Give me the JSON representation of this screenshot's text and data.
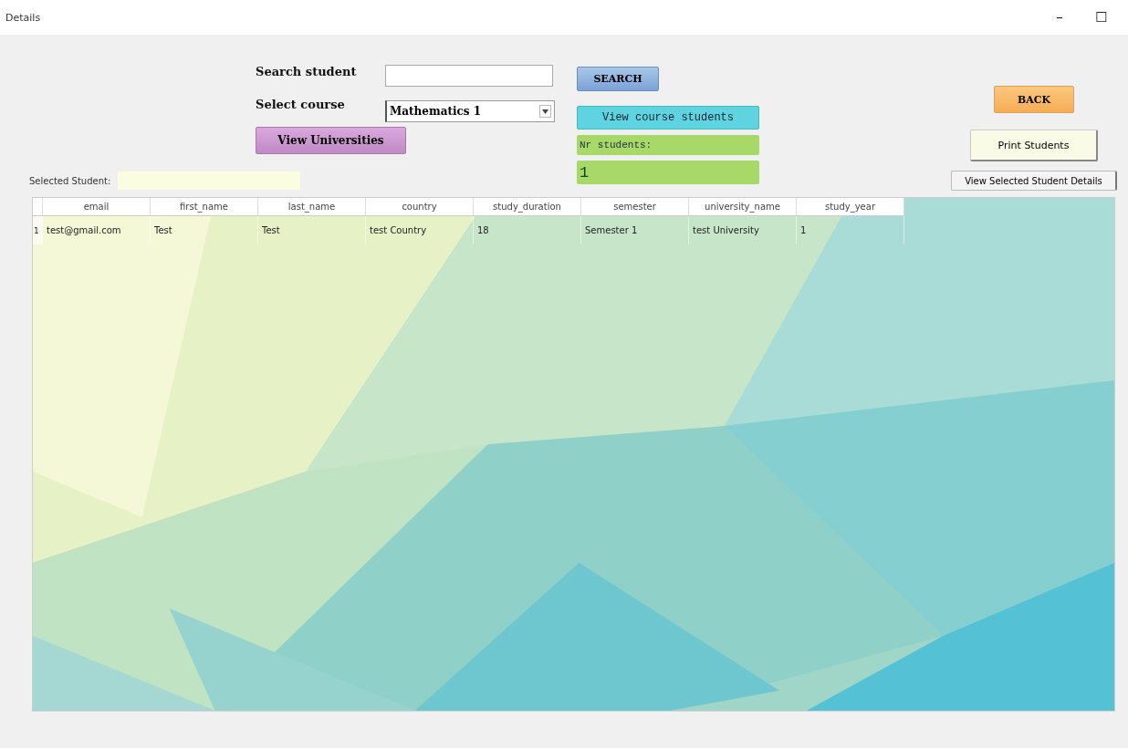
{
  "window": {
    "title": "Details",
    "controls": [
      "–",
      "☐"
    ]
  },
  "search": {
    "label": "Search student",
    "button": "SEARCH"
  },
  "course": {
    "label": "Select course",
    "value": "Mathematics 1",
    "button": "View course students"
  },
  "universities_button": "View Universities",
  "count": {
    "label": "Nr students:",
    "value": "1"
  },
  "back_button": "BACK",
  "print_button": "Print Students",
  "details_button": "View Selected Student Details",
  "selected_student": {
    "label": "Selected Student:"
  },
  "table": {
    "columns": [
      "email",
      "first_name",
      "last_name",
      "country",
      "study_duration",
      "semester",
      "university_name",
      "study_year"
    ],
    "rows": [
      {
        "index": "1",
        "cells": [
          "test@gmail.com",
          "Test",
          "Test",
          "test Country",
          "18",
          "Semester 1",
          "test University",
          "1"
        ]
      }
    ]
  }
}
